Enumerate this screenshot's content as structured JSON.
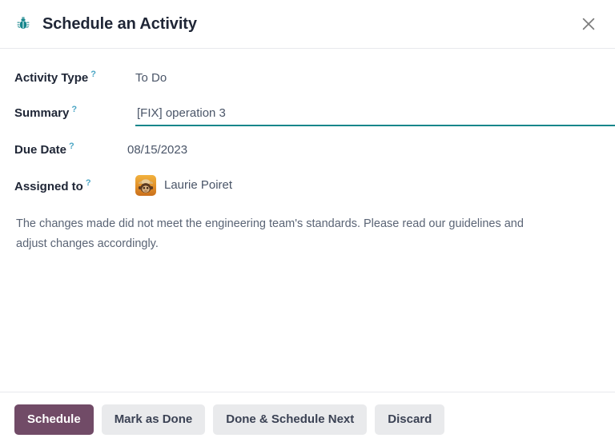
{
  "dialog": {
    "title": "Schedule an Activity",
    "title_icon": "bug-icon",
    "close_icon": "close-icon",
    "accent_color": "#714b67",
    "icon_color": "#16858b",
    "focus_underline_color": "#17868b",
    "help_marker": "?"
  },
  "fields": {
    "activity_type": {
      "label": "Activity Type",
      "value": "To Do"
    },
    "summary": {
      "label": "Summary",
      "value": "[FIX] operation 3",
      "placeholder": ""
    },
    "due_date": {
      "label": "Due Date",
      "value": "08/15/2023"
    },
    "assigned_to": {
      "label": "Assigned to",
      "value": "Laurie Poiret",
      "avatar_icon": "user-avatar-image"
    }
  },
  "description": {
    "text": "The changes made did not meet the engineering team's standards. Please read our guidelines and adjust changes accordingly."
  },
  "footer": {
    "schedule_label": "Schedule",
    "mark_done_label": "Mark as Done",
    "done_schedule_next_label": "Done & Schedule Next",
    "discard_label": "Discard"
  }
}
